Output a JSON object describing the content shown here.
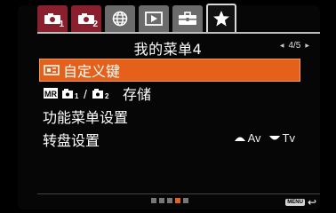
{
  "tabs": [
    {
      "icon": "camera-icon",
      "num": "1",
      "state": "camera"
    },
    {
      "icon": "camera-icon",
      "num": "2",
      "state": "camera"
    },
    {
      "icon": "globe-icon",
      "num": "",
      "state": "normal"
    },
    {
      "icon": "playback-icon",
      "num": "",
      "state": "normal"
    },
    {
      "icon": "toolbox-icon",
      "num": "",
      "state": "normal"
    },
    {
      "icon": "star-icon",
      "num": "",
      "state": "active"
    }
  ],
  "header": {
    "title": "我的菜单4",
    "page": "4/5"
  },
  "menu": {
    "items": [
      {
        "label": "自定义键",
        "icon": "custom-key-icon",
        "selected": true
      },
      {
        "label": "存储",
        "icon": "mr-memory-icon",
        "prefix": "MR",
        "selected": false
      },
      {
        "label": "功能菜单设置",
        "selected": false
      },
      {
        "label": "转盘设置",
        "selected": false,
        "value_av": "Av",
        "value_tv": "Tv"
      }
    ]
  },
  "footer": {
    "pages_total": 5,
    "page_current": 4,
    "menu_label": "MENU",
    "back_symbol": "↩"
  },
  "colors": {
    "selection": "#e5601a",
    "camera_tab": "#8a1f2d"
  }
}
